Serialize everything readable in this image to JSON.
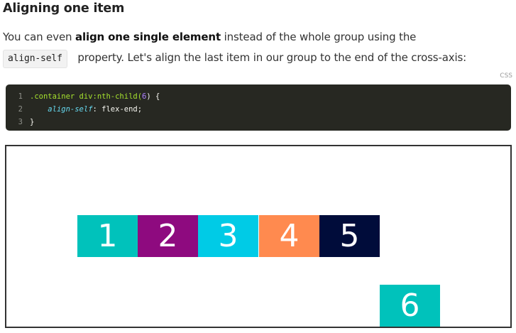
{
  "heading": "Aligning one item",
  "paragraph": {
    "part1": "You can even ",
    "bold": "align one single element",
    "part2": " instead of the whole group using the",
    "code": "align-self",
    "part3": " property. Let's align the last item in our group to the end of the cross-axis:"
  },
  "code_block": {
    "language": "CSS",
    "lines": [
      {
        "number": "1",
        "selector": ".container div:nth-child(",
        "arg": "6",
        "rest": ") {"
      },
      {
        "number": "2",
        "property": "align-self",
        "value": ": flex-end;"
      },
      {
        "number": "3",
        "text": "}"
      }
    ]
  },
  "demo": {
    "items": [
      {
        "label": "1",
        "color": "#00c2bb"
      },
      {
        "label": "2",
        "color": "#8e0a7f"
      },
      {
        "label": "3",
        "color": "#00cbe6"
      },
      {
        "label": "4",
        "color": "#ff8a4f"
      },
      {
        "label": "5",
        "color": "#000c3a"
      },
      {
        "label": "6",
        "color": "#00c2bb"
      }
    ]
  }
}
